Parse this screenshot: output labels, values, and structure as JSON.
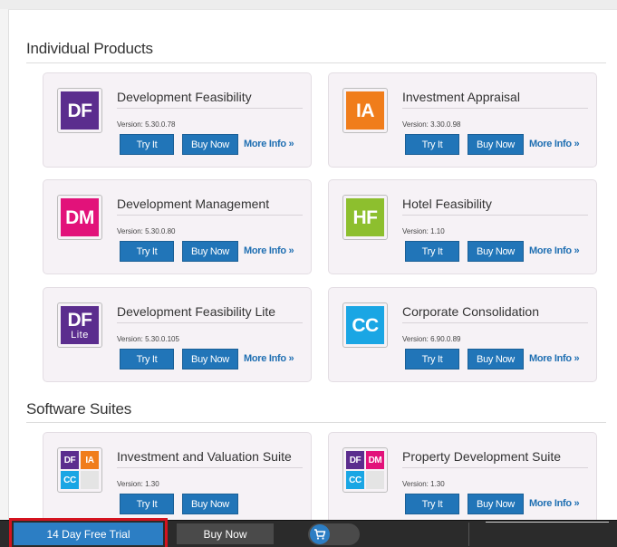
{
  "sections": {
    "individual_title": "Individual Products",
    "suites_title": "Software Suites"
  },
  "labels": {
    "try": "Try It",
    "buy": "Buy Now",
    "more": "More Info »"
  },
  "products": [
    {
      "name": "Development Feasibility",
      "version": "Version: 5.30.0.78",
      "logo_text": "DF",
      "logo_sub": "",
      "color": "#5b2d8e"
    },
    {
      "name": "Investment Appraisal",
      "version": "Version: 3.30.0.98",
      "logo_text": "IA",
      "logo_sub": "",
      "color": "#f07d1b"
    },
    {
      "name": "Development Management",
      "version": "Version: 5.30.0.80",
      "logo_text": "DM",
      "logo_sub": "",
      "color": "#e2127a"
    },
    {
      "name": "Hotel Feasibility",
      "version": "Version: 1.10",
      "logo_text": "HF",
      "logo_sub": "",
      "color": "#8dbf2e"
    },
    {
      "name": "Development Feasibility Lite",
      "version": "Version: 5.30.0.105",
      "logo_text": "DF",
      "logo_sub": "Lite",
      "color": "#5b2d8e"
    },
    {
      "name": "Corporate Consolidation",
      "version": "Version: 6.90.0.89",
      "logo_text": "CC",
      "logo_sub": "",
      "color": "#1aa6e4"
    }
  ],
  "suites": [
    {
      "name": "Investment and Valuation Suite",
      "version": "Version: 1.30",
      "cells": [
        "DF",
        "IA",
        "CC"
      ],
      "colors": [
        "#5b2d8e",
        "#f07d1b",
        "#1aa6e4"
      ]
    },
    {
      "name": "Property Development Suite",
      "version": "Version: 1.30",
      "cells": [
        "DF",
        "DM",
        "CC"
      ],
      "colors": [
        "#5b2d8e",
        "#e2127a",
        "#1aa6e4"
      ]
    }
  ],
  "bottom": {
    "trial": "14 Day Free Trial",
    "buy": "Buy Now",
    "cart_icon": "cart-icon"
  }
}
